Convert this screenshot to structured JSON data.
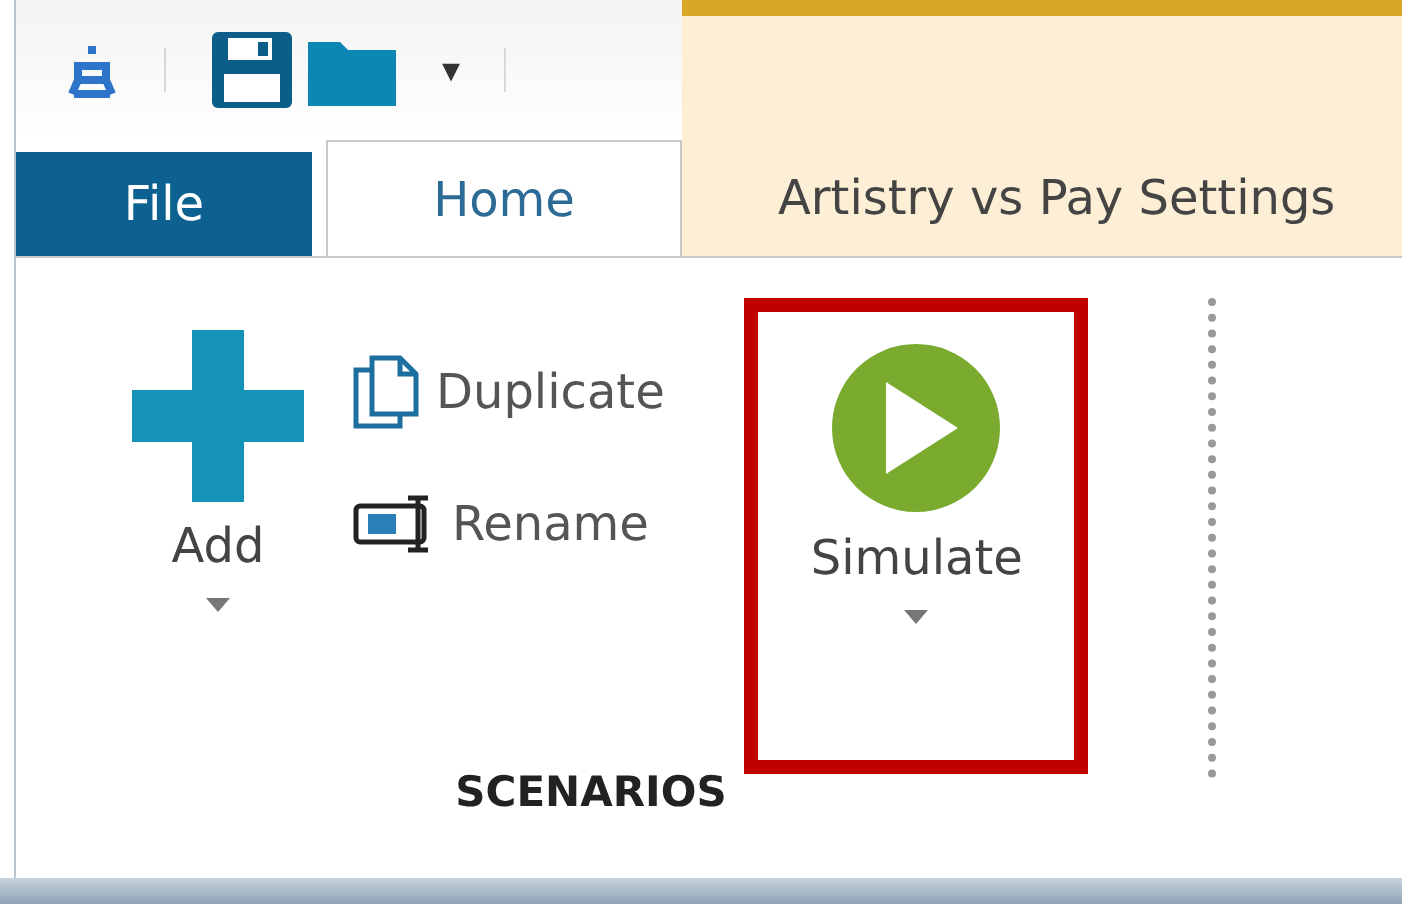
{
  "quick_access": [
    {
      "kind": "app"
    },
    {
      "kind": "save"
    },
    {
      "kind": "open"
    },
    {
      "kind": "customize",
      "label": "▾"
    }
  ],
  "tabs": [
    {
      "label": "File",
      "kind": "file",
      "selected": false
    },
    {
      "label": "Home",
      "kind": "tab",
      "selected": true
    },
    {
      "label": "Artistry vs Pay Settings",
      "kind": "contextual",
      "selected": false
    }
  ],
  "ribbon": {
    "groups": [
      {
        "title": "SCENARIOS",
        "buttons": [
          {
            "label": "Add",
            "kind": "large-add",
            "dropdown": true,
            "highlighted": false
          },
          {
            "label": "Duplicate",
            "kind": "small-duplicate"
          },
          {
            "label": "Rename",
            "kind": "small-rename"
          },
          {
            "label": "Simulate",
            "kind": "large-simulate",
            "dropdown": true,
            "highlighted": true
          }
        ]
      }
    ]
  }
}
